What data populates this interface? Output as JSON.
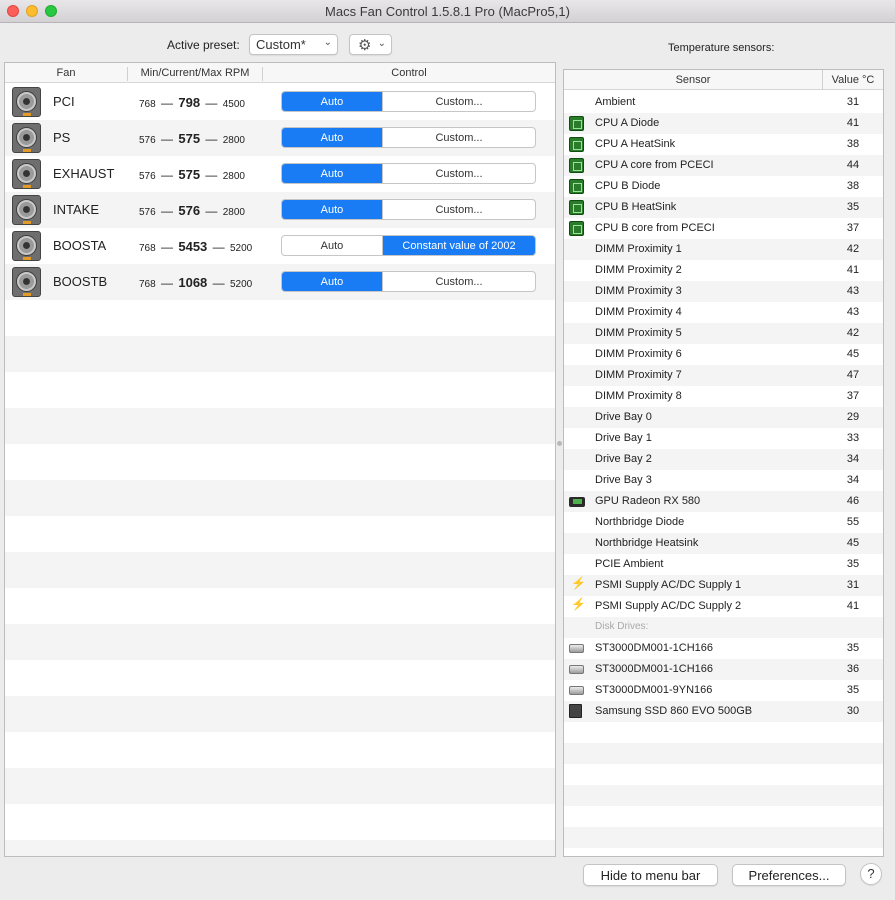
{
  "window": {
    "title": "Macs Fan Control 1.5.8.1 Pro (MacPro5,1)"
  },
  "toolbar": {
    "preset_label": "Active preset:",
    "preset_value": "Custom*",
    "sensors_label": "Temperature sensors:"
  },
  "fan_table": {
    "headers": {
      "fan": "Fan",
      "rpm": "Min/Current/Max RPM",
      "control": "Control"
    },
    "rows": [
      {
        "name": "PCI",
        "min": "768",
        "current": "798",
        "max": "4500",
        "auto": "Auto",
        "custom": "Custom...",
        "mode": "auto"
      },
      {
        "name": "PS",
        "min": "576",
        "current": "575",
        "max": "2800",
        "auto": "Auto",
        "custom": "Custom...",
        "mode": "auto"
      },
      {
        "name": "EXHAUST",
        "min": "576",
        "current": "575",
        "max": "2800",
        "auto": "Auto",
        "custom": "Custom...",
        "mode": "auto"
      },
      {
        "name": "INTAKE",
        "min": "576",
        "current": "576",
        "max": "2800",
        "auto": "Auto",
        "custom": "Custom...",
        "mode": "auto"
      },
      {
        "name": "BOOSTA",
        "min": "768",
        "current": "5453",
        "max": "5200",
        "auto": "Auto",
        "custom": "Constant value of 2002",
        "mode": "custom"
      },
      {
        "name": "BOOSTB",
        "min": "768",
        "current": "1068",
        "max": "5200",
        "auto": "Auto",
        "custom": "Custom...",
        "mode": "auto"
      }
    ]
  },
  "sensor_table": {
    "headers": {
      "sensor": "Sensor",
      "value": "Value °C"
    },
    "rows": [
      {
        "name": "Ambient",
        "value": "31",
        "icon": ""
      },
      {
        "name": "CPU A Diode",
        "value": "41",
        "icon": "cpu-chip-icon"
      },
      {
        "name": "CPU A HeatSink",
        "value": "38",
        "icon": "cpu-chip-icon"
      },
      {
        "name": "CPU A core from PCECI",
        "value": "44",
        "icon": "cpu-chip-icon"
      },
      {
        "name": "CPU B Diode",
        "value": "38",
        "icon": "cpu-chip-icon"
      },
      {
        "name": "CPU B HeatSink",
        "value": "35",
        "icon": "cpu-chip-icon"
      },
      {
        "name": "CPU B core from PCECI",
        "value": "37",
        "icon": "cpu-chip-icon"
      },
      {
        "name": "DIMM Proximity 1",
        "value": "42",
        "icon": ""
      },
      {
        "name": "DIMM Proximity 2",
        "value": "41",
        "icon": ""
      },
      {
        "name": "DIMM Proximity 3",
        "value": "43",
        "icon": ""
      },
      {
        "name": "DIMM Proximity 4",
        "value": "43",
        "icon": ""
      },
      {
        "name": "DIMM Proximity 5",
        "value": "42",
        "icon": ""
      },
      {
        "name": "DIMM Proximity 6",
        "value": "45",
        "icon": ""
      },
      {
        "name": "DIMM Proximity 7",
        "value": "47",
        "icon": ""
      },
      {
        "name": "DIMM Proximity 8",
        "value": "37",
        "icon": ""
      },
      {
        "name": "Drive Bay 0",
        "value": "29",
        "icon": ""
      },
      {
        "name": "Drive Bay 1",
        "value": "33",
        "icon": ""
      },
      {
        "name": "Drive Bay 2",
        "value": "34",
        "icon": ""
      },
      {
        "name": "Drive Bay 3",
        "value": "34",
        "icon": ""
      },
      {
        "name": "GPU Radeon RX 580",
        "value": "46",
        "icon": "gpu-card-icon"
      },
      {
        "name": "Northbridge Diode",
        "value": "55",
        "icon": ""
      },
      {
        "name": "Northbridge Heatsink",
        "value": "45",
        "icon": ""
      },
      {
        "name": "PCIE Ambient",
        "value": "35",
        "icon": ""
      },
      {
        "name": "PSMI Supply AC/DC Supply 1",
        "value": "31",
        "icon": "lightning-bolt-icon"
      },
      {
        "name": "PSMI Supply AC/DC Supply 2",
        "value": "41",
        "icon": "lightning-bolt-icon"
      },
      {
        "name": "Disk Drives:",
        "value": "",
        "icon": "",
        "section": true
      },
      {
        "name": "ST3000DM001-1CH166",
        "value": "35",
        "icon": "hard-drive-icon"
      },
      {
        "name": "ST3000DM001-1CH166",
        "value": "36",
        "icon": "hard-drive-icon"
      },
      {
        "name": "ST3000DM001-9YN166",
        "value": "35",
        "icon": "hard-drive-icon"
      },
      {
        "name": "Samsung SSD 860 EVO 500GB",
        "value": "30",
        "icon": "ssd-drive-icon"
      }
    ]
  },
  "footer": {
    "hide_label": "Hide to menu bar",
    "prefs_label": "Preferences...",
    "help_label": "?"
  },
  "colors": {
    "accent": "#1a7cf5",
    "chip": "#2a7b2a",
    "bolt": "#e9b000"
  }
}
